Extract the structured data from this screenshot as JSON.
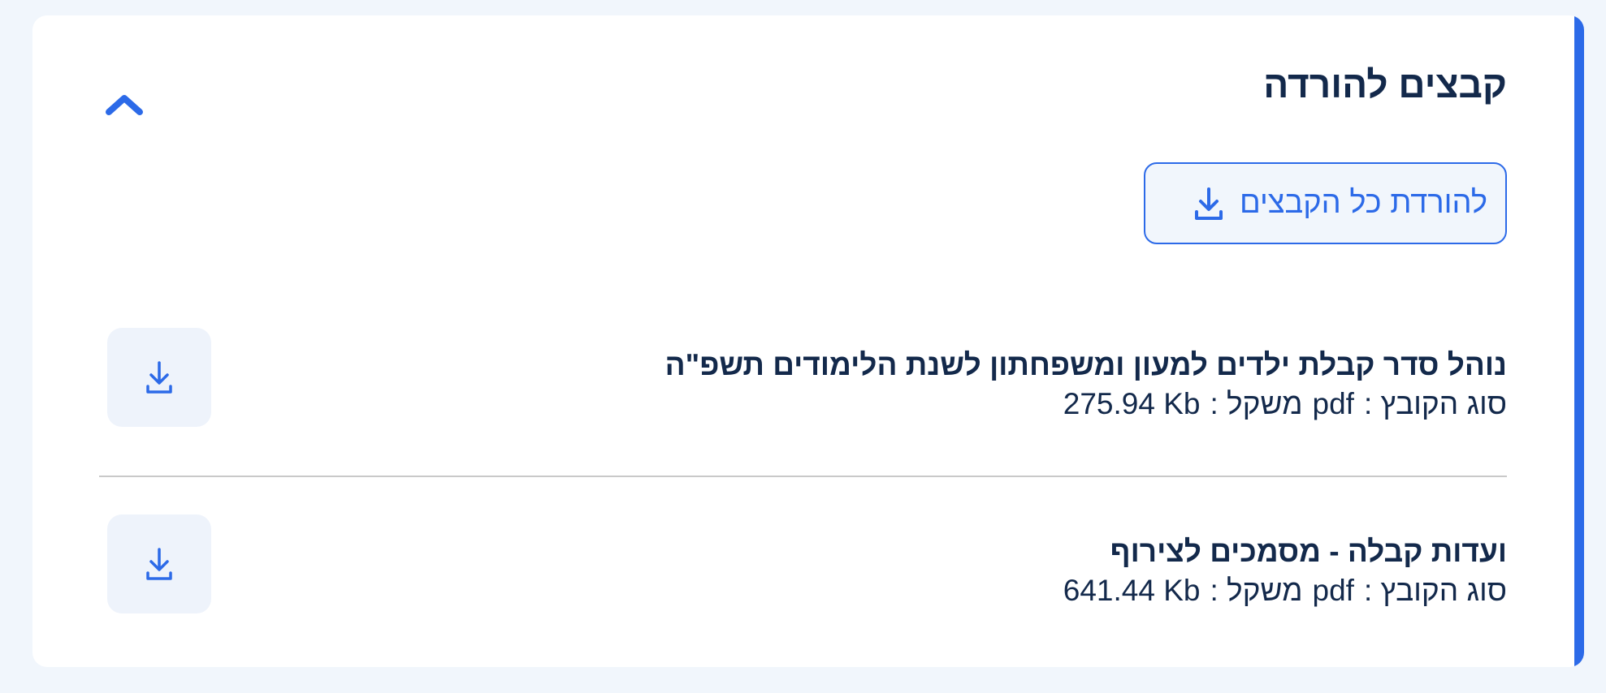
{
  "section": {
    "title": "קבצים להורדה",
    "download_all_label": "להורדת כל הקבצים"
  },
  "files": [
    {
      "title": "נוהל סדר קבלת ילדים למעון ומשפחתון לשנת הלימודים תשפ\"ה",
      "type_label": "סוג הקובץ :",
      "type_value": "pdf",
      "size_label": "משקל :",
      "size_value": "275.94 Kb"
    },
    {
      "title": "ועדות קבלה - מסמכים לצירוף",
      "type_label": "סוג הקובץ :",
      "type_value": "pdf",
      "size_label": "משקל :",
      "size_value": "641.44 Kb"
    }
  ],
  "icons": {
    "collapse": "chevron-up-icon",
    "download": "download-icon"
  },
  "colors": {
    "accent": "#2c6ae8",
    "text": "#13294b",
    "background": "#f1f6fc",
    "card": "#ffffff"
  }
}
